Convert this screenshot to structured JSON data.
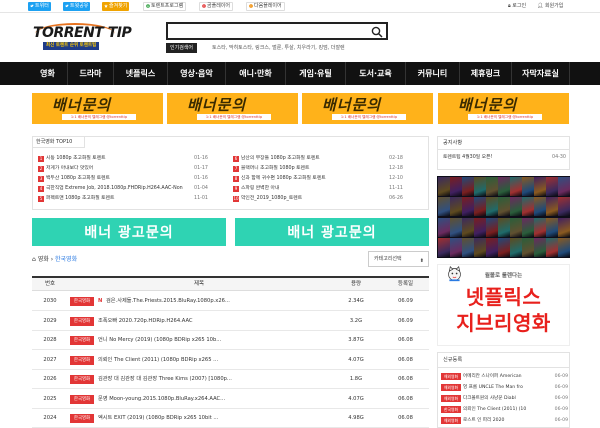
{
  "topbar": {
    "left_buttons": [
      {
        "label": "트위터",
        "icon": "twitter-icon",
        "style": "blue"
      },
      {
        "label": "트윗공유",
        "icon": "twitter-icon",
        "style": "blue"
      },
      {
        "label": "즐겨찾기",
        "icon": "star-icon",
        "style": "orange"
      },
      {
        "label": "토렌트프로그램",
        "icon": "download-icon",
        "style": "plain"
      },
      {
        "label": "곰플레이어",
        "icon": "player-icon",
        "style": "plain"
      },
      {
        "label": "다음플레이어",
        "icon": "player-icon",
        "style": "plain"
      }
    ],
    "login_label": "로그인",
    "join_label": "회원가입"
  },
  "header": {
    "logo_text": "TORRENT TIP",
    "logo_sub": "최신 토렌트 순위 토렌트팁",
    "search_value": "",
    "hot_label": "인기검색어",
    "hot_terms": "토스타, 막히토스타, 링크스, 벌룬, 투살, 치우라기, 킹덤, 더잘렌"
  },
  "nav": [
    "영화",
    "드라마",
    "넷플릭스",
    "영상·음악",
    "애니·만화",
    "게임·유틸",
    "도서·교육",
    "커뮤니티",
    "제휴링크",
    "자막자료실"
  ],
  "banners": {
    "title": "배너문의",
    "sub": "1:1 배너문의 텔레그램 @torrenttip",
    "count": 4
  },
  "top10": {
    "tab_label": "한국영화 TOP10",
    "left": [
      {
        "num": "1",
        "title": "시동 1080p 초고화질 토렌트",
        "date": "01-16"
      },
      {
        "num": "2",
        "title": "저게가 아내보다 맛있어",
        "date": "01-17"
      },
      {
        "num": "3",
        "title": "백두산 1080p 초고화질 토렌트",
        "date": "01-16"
      },
      {
        "num": "4",
        "title": "극한직업 Extreme Job, 2018.1080p.FHDRip.H264.AAC-Non",
        "date": "01-04"
      },
      {
        "num": "5",
        "title": "퍼펙트맨 1080p 초고화질 토렌트",
        "date": "11-01"
      }
    ],
    "right": [
      {
        "num": "6",
        "title": "남산의 부장들 1080p 초고화질 토렌트",
        "date": "02-18"
      },
      {
        "num": "7",
        "title": "블랙머니 초고화질 1080p 토렌트",
        "date": "12-18"
      },
      {
        "num": "8",
        "title": "신과 함께 귀수편 1080p 초고화질 토렌트",
        "date": "12-10"
      },
      {
        "num": "9",
        "title": "스파링 완벽한 아내",
        "date": "11-11"
      },
      {
        "num": "10",
        "title": "악인전_2019_1080p_토렌트",
        "date": "06-26"
      }
    ]
  },
  "ads2": {
    "text": "배너 광고문의"
  },
  "breadcrumb": {
    "home": "영화",
    "current": "한국영화"
  },
  "category_select": {
    "value": "카테고리선택"
  },
  "table": {
    "headers": {
      "num": "번호",
      "title": "제목",
      "size": "용량",
      "date": "등록일"
    },
    "rows": [
      {
        "num": "2030",
        "cat": "한국영화",
        "title": "검은.사제들.The.Priests.2015.BluRay.1080p.x26...",
        "size": "2.34G",
        "date": "06.09",
        "new": true
      },
      {
        "num": "2029",
        "cat": "한국영화",
        "title": "조폭오빠 2020.720p.HDRip.H264.AAC",
        "size": "3.2G",
        "date": "06.09",
        "new": false
      },
      {
        "num": "2028",
        "cat": "한국영화",
        "title": "언니 No Mercy (2019) (1080p BDRip x265 10b...",
        "size": "3.87G",
        "date": "06.08",
        "new": false
      },
      {
        "num": "2027",
        "cat": "한국영화",
        "title": "의뢰인 The Client (2011) (1080p BDRip x265 ...",
        "size": "4.07G",
        "date": "06.08",
        "new": false
      },
      {
        "num": "2026",
        "cat": "한국영화",
        "title": "김관장 대 김관장 대 김관장 Three Kims (2007) [1080p...",
        "size": "1.8G",
        "date": "06.08",
        "new": false
      },
      {
        "num": "2025",
        "cat": "한국영화",
        "title": "문영 Moon-young.2015.1080p.BluRay.x264.AAC...",
        "size": "4.07G",
        "date": "06.08",
        "new": false
      },
      {
        "num": "2024",
        "cat": "한국영화",
        "title": "엑시트 EXIT (2019) (1080p BDRip x265 10bit ...",
        "size": "4.98G",
        "date": "06.08",
        "new": false
      }
    ]
  },
  "notice": {
    "head": "공지사항",
    "row_title": "토렌트팁 4월30일 오픈!",
    "row_date": "04-30"
  },
  "promo": {
    "top": "월볼로 룰렌다는",
    "line1": "넷플릭스",
    "line2": "지브리영화"
  },
  "newreg": {
    "head": "신규등록",
    "rows": [
      {
        "cat": "해외영화",
        "title": "어메리칸 스나이퍼 American",
        "date": "06-09"
      },
      {
        "cat": "해외영화",
        "title": "엉 프롬 UNCLE The Man fro",
        "date": "06-09"
      },
      {
        "cat": "해외영화",
        "title": "다크볼트원의 사냥꾼 Diabl",
        "date": "06-09"
      },
      {
        "cat": "한국영화",
        "title": "의뢰인 The Client (2011) (10",
        "date": "06-09"
      },
      {
        "cat": "해외영화",
        "title": "로스트 인 파리 2020",
        "date": "06-09"
      }
    ]
  },
  "colors": {
    "accent": "#e23636",
    "nav_bg": "#111111",
    "banner": "#ffb21a",
    "ad": "#2fd3b3",
    "link": "#2a7ae2"
  }
}
